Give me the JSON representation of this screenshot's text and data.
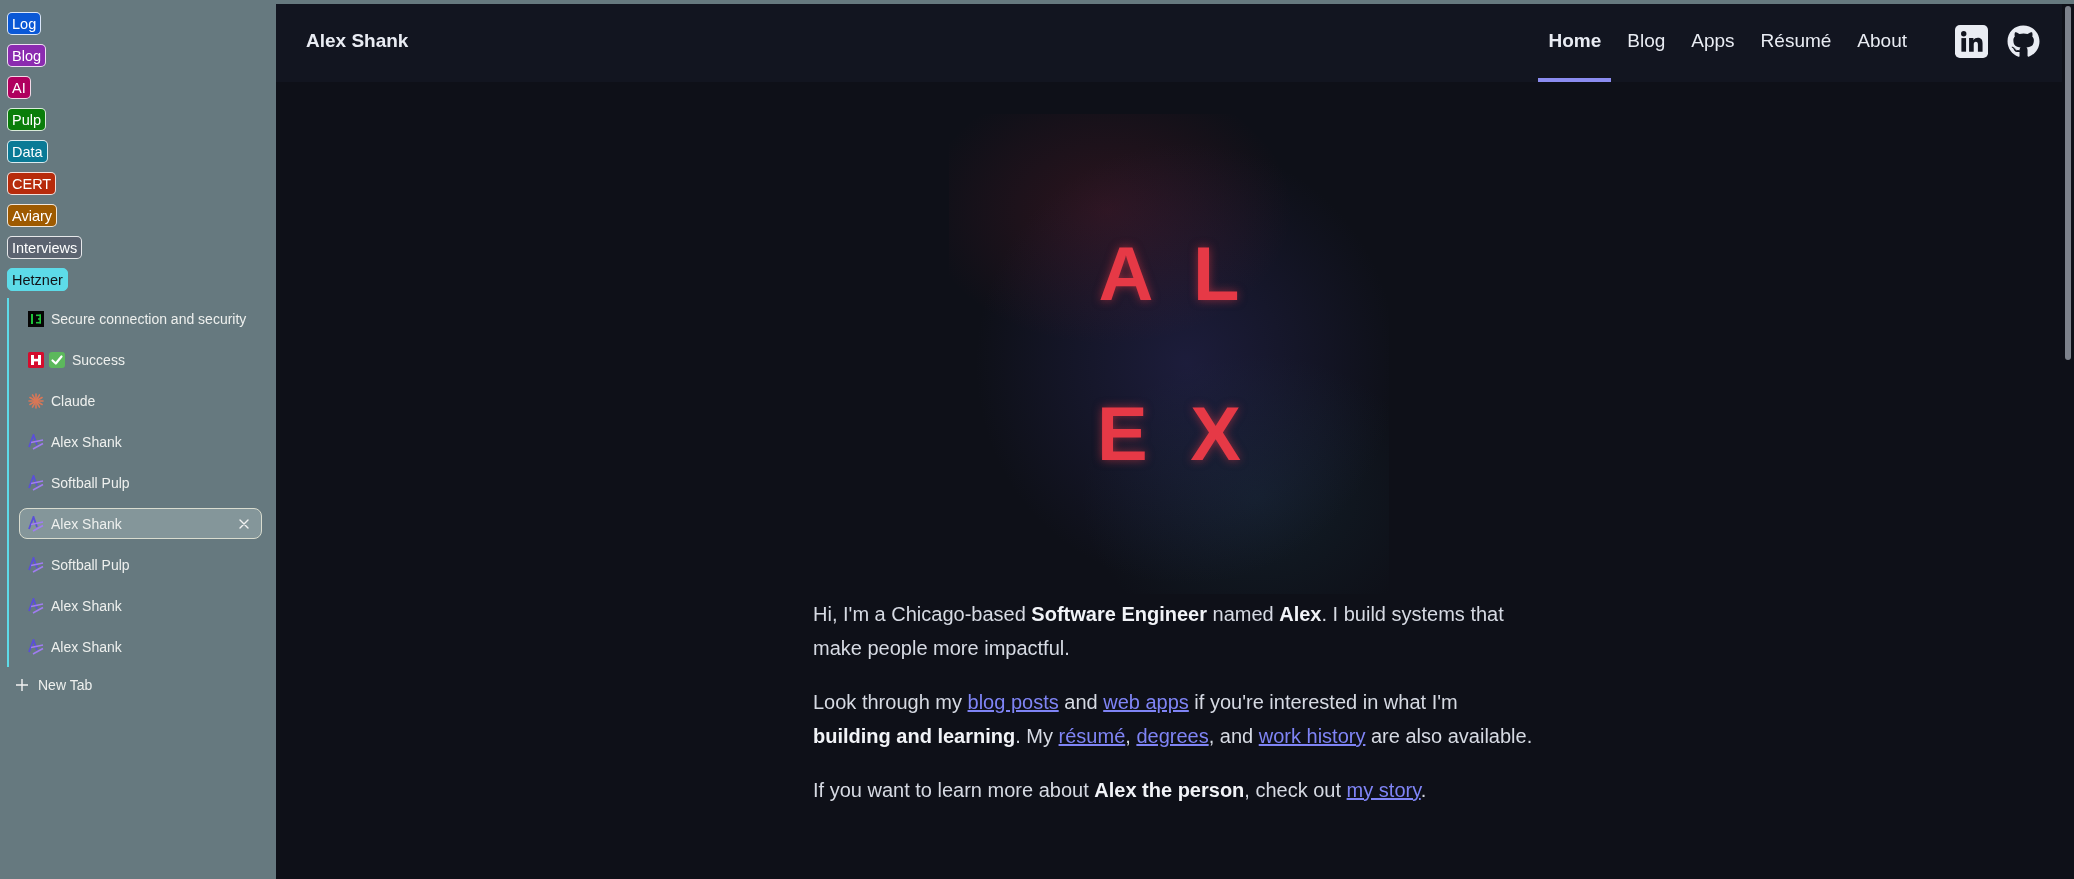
{
  "sidebar": {
    "groups": [
      {
        "label": "Log",
        "color": "#0a58d6",
        "expanded": false
      },
      {
        "label": "Blog",
        "color": "#8b2bb0",
        "expanded": false
      },
      {
        "label": "AI",
        "color": "#b0005e",
        "expanded": false
      },
      {
        "label": "Pulp",
        "color": "#0a7d0a",
        "expanded": false
      },
      {
        "label": "Data",
        "color": "#0a7a96",
        "expanded": false
      },
      {
        "label": "CERT",
        "color": "#b72b0b",
        "expanded": false
      },
      {
        "label": "Aviary",
        "color": "#9e5a00",
        "expanded": false
      },
      {
        "label": "Interviews",
        "color": "#5b6370",
        "expanded": false
      },
      {
        "label": "Hetzner",
        "color": "#5ddbe8",
        "expanded": true,
        "tabs": [
          {
            "kind": "terminal",
            "title": "Secure connection and security",
            "check_mark": false,
            "selected": false
          },
          {
            "kind": "hetzner",
            "title": "Success",
            "check_mark": true,
            "selected": false
          },
          {
            "kind": "claude",
            "title": "Claude",
            "check_mark": false,
            "selected": false
          },
          {
            "kind": "site",
            "title": "Alex Shank",
            "check_mark": false,
            "selected": false
          },
          {
            "kind": "site",
            "title": "Softball Pulp",
            "check_mark": false,
            "selected": false
          },
          {
            "kind": "site",
            "title": "Alex Shank",
            "check_mark": false,
            "selected": true
          },
          {
            "kind": "site",
            "title": "Softball Pulp",
            "check_mark": false,
            "selected": false
          },
          {
            "kind": "site",
            "title": "Alex Shank",
            "check_mark": false,
            "selected": false
          },
          {
            "kind": "site",
            "title": "Alex Shank",
            "check_mark": false,
            "selected": false
          }
        ]
      }
    ],
    "new_tab": {
      "label": "New Tab"
    }
  },
  "header": {
    "site_title": "Alex Shank",
    "nav": [
      {
        "label": "Home",
        "selected": true
      },
      {
        "label": "Blog",
        "selected": false
      },
      {
        "label": "Apps",
        "selected": false
      },
      {
        "label": "Résumé",
        "selected": false
      },
      {
        "label": "About",
        "selected": false
      }
    ]
  },
  "hero": {
    "logo_rows": [
      "A L",
      "E X"
    ]
  },
  "intro": {
    "paragraphs": [
      {
        "parts": [
          {
            "kind": "text",
            "text": "Hi, I'm a Chicago-based **Software Engineer** named **Alex**. I build systems that make people more impactful."
          }
        ]
      },
      {
        "parts": [
          {
            "kind": "text",
            "text": "Look through my "
          },
          {
            "kind": "link",
            "text": "blog posts"
          },
          {
            "kind": "text",
            "text": " and "
          },
          {
            "kind": "link",
            "text": "web apps"
          },
          {
            "kind": "text",
            "text": " if you're interested in what I'm **building and learning**. My "
          },
          {
            "kind": "link",
            "text": "résumé"
          },
          {
            "kind": "text",
            "text": ", "
          },
          {
            "kind": "link",
            "text": "degrees"
          },
          {
            "kind": "text",
            "text": ", and "
          },
          {
            "kind": "link",
            "text": "work history"
          },
          {
            "kind": "text",
            "text": " are also available."
          }
        ]
      },
      {
        "parts": [
          {
            "kind": "text",
            "text": "If you want to learn more about **Alex the person**, check out "
          },
          {
            "kind": "link",
            "text": "my story"
          },
          {
            "kind": "text",
            "text": "."
          }
        ]
      }
    ]
  }
}
